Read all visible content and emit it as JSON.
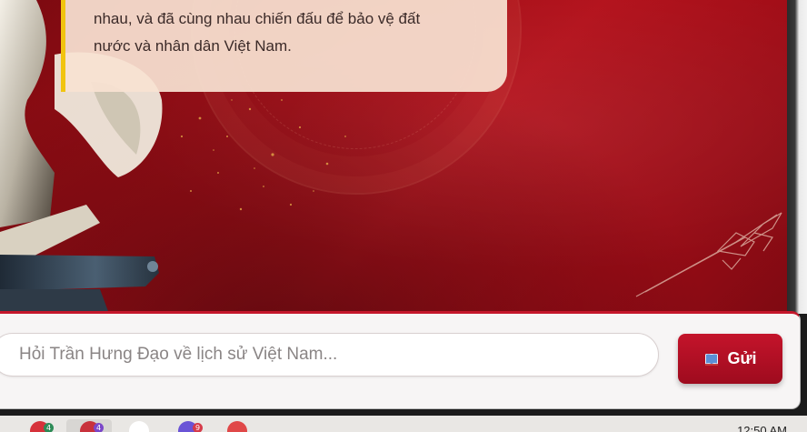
{
  "speech_bubble": {
    "line1": "nhau, và đã cùng nhau chiến đấu để bảo vệ đất",
    "line2": "nước và nhân dân Việt Nam."
  },
  "chat": {
    "placeholder": "Hỏi Trần Hưng Đạo về lịch sử Việt Nam...",
    "send_label": "Gửi",
    "send_icon": "book-icon"
  },
  "taskbar": {
    "clock": "12:50 AM",
    "badges": [
      "4",
      "4",
      "9"
    ]
  },
  "colors": {
    "background_red": "#a10e17",
    "accent_red": "#c4142b",
    "bubble_border": "#f1c40f"
  }
}
